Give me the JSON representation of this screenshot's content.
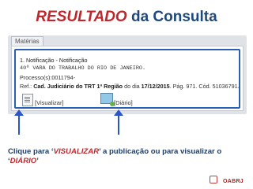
{
  "heading": {
    "red": "RESULTADO",
    "blue": "da Consulta"
  },
  "panel": {
    "tab_label": "Matérias",
    "result": {
      "title": "1. Notificação - Notificação",
      "court": "40ª VARA DO TRABALHO DO RIO DE JANEIRO.",
      "process": "Processo(s):0011794-",
      "ref_prefix": "Ref.: ",
      "ref_source": "Cad. Judiciário do TRT 1ª Região",
      "ref_mid": " do dia ",
      "ref_date": "17/12/2015",
      "ref_suffix": ". Pág. 971. Cód. 51036791."
    },
    "actions": {
      "view_label": "[Visualizar]",
      "diary_label": "[Diário]"
    }
  },
  "caption": {
    "part1": "Clique para ‘",
    "view_word": "VISUALIZAR",
    "part2": "’ a publicação ou para  visualizar o ‘",
    "diary_word": "DIÁRIO",
    "part3": "’"
  },
  "logo": {
    "text": "OABRJ"
  }
}
